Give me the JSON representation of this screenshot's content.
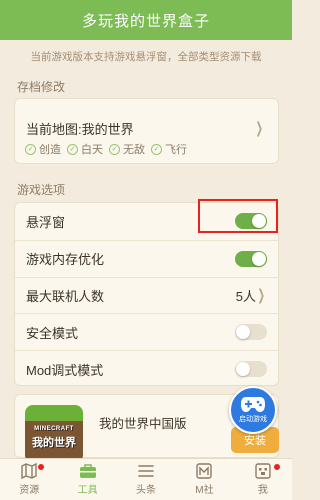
{
  "header": {
    "title": "多玩我的世界盒子"
  },
  "notice": "当前游戏版本支持游戏悬浮窗，全部类型资源下载",
  "save_section": {
    "title": "存档修改",
    "map_label": "当前地图:我的世界",
    "tags": [
      "创造",
      "白天",
      "无敌",
      "飞行"
    ]
  },
  "options_section": {
    "title": "游戏选项",
    "rows": [
      {
        "label": "悬浮窗",
        "toggle": true
      },
      {
        "label": "游戏内存优化",
        "toggle": true
      },
      {
        "label": "最大联机人数",
        "value": "5人"
      },
      {
        "label": "安全模式",
        "toggle": false
      },
      {
        "label": "Mod调式模式",
        "toggle": false
      }
    ]
  },
  "game_card": {
    "icon_text_1": "MINECRAFT",
    "icon_text_2": "我的世界",
    "name": "我的世界中国版",
    "install_label": "安装"
  },
  "fab": {
    "label": "启动游戏"
  },
  "tabs": [
    {
      "label": "资源",
      "icon": "map-icon",
      "badge": true
    },
    {
      "label": "工具",
      "icon": "toolbox-icon",
      "active": true
    },
    {
      "label": "头条",
      "icon": "news-icon"
    },
    {
      "label": "M社",
      "icon": "community-icon"
    },
    {
      "label": "我",
      "icon": "profile-icon",
      "badge": true
    }
  ],
  "colors": {
    "accent": "#7dbb55",
    "toggle_on": "#6eaf47",
    "background": "#f3ecde",
    "highlight": "#e8231d",
    "install": "#efad3d",
    "fab": "#2d7be0"
  }
}
